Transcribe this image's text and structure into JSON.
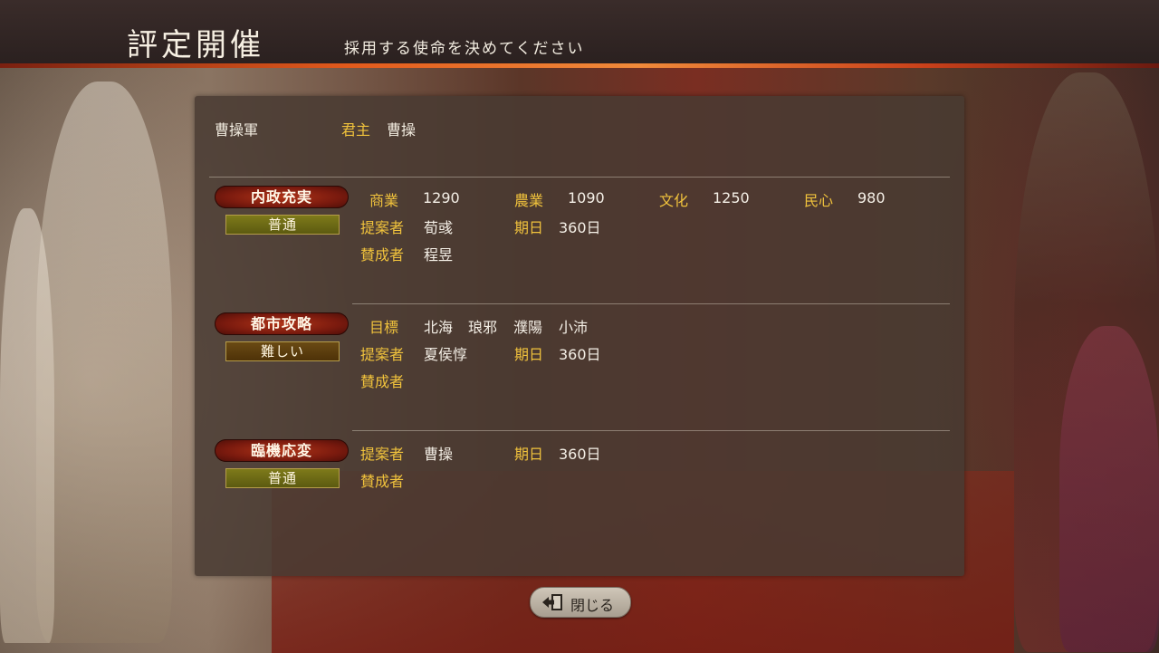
{
  "header": {
    "title": "評定開催",
    "subtitle": "採用する使命を決めてください"
  },
  "faction": {
    "name": "曹操軍",
    "lord_label": "君主",
    "lord_name": "曹操"
  },
  "missions": [
    {
      "name": "内政充実",
      "difficulty": "普通",
      "stats": [
        {
          "label": "商業",
          "value": "1290"
        },
        {
          "label": "農業",
          "value": "1090"
        },
        {
          "label": "文化",
          "value": "1250"
        },
        {
          "label": "民心",
          "value": "980"
        }
      ],
      "proposer_label": "提案者",
      "proposer": "荀彧",
      "deadline_label": "期日",
      "deadline": "360日",
      "supporters_label": "賛成者",
      "supporters": "程昱"
    },
    {
      "name": "都市攻略",
      "difficulty": "難しい",
      "target_label": "目標",
      "targets": [
        "北海",
        "琅邪",
        "濮陽",
        "小沛"
      ],
      "proposer_label": "提案者",
      "proposer": "夏侯惇",
      "deadline_label": "期日",
      "deadline": "360日",
      "supporters_label": "賛成者",
      "supporters": ""
    },
    {
      "name": "臨機応変",
      "difficulty": "普通",
      "proposer_label": "提案者",
      "proposer": "曹操",
      "deadline_label": "期日",
      "deadline": "360日",
      "supporters_label": "賛成者",
      "supporters": ""
    }
  ],
  "close_button": {
    "label": "閉じる",
    "icon": "exit-door-icon"
  }
}
